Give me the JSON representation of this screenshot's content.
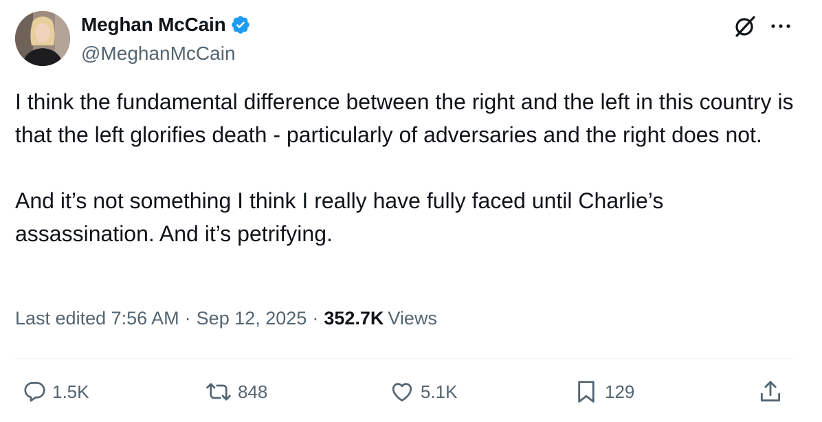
{
  "author": {
    "display_name": "Meghan McCain",
    "handle": "@MeghanMcCain",
    "verified": true,
    "verified_color": "#1d9bf0"
  },
  "tweet": {
    "paragraphs": [
      "I think the fundamental difference between the right and the left in this country is that the left glorifies death - particularly of adversaries and the right does not.",
      "And it’s not something I think I really have fully faced until Charlie’s assassination. And it’s petrifying."
    ]
  },
  "meta": {
    "edited_label": "Last edited 7:56 AM",
    "date": "Sep 12, 2025",
    "views_count": "352.7K",
    "views_label": "Views",
    "separator": "·"
  },
  "actions": {
    "replies": "1.5K",
    "reposts": "848",
    "likes": "5.1K",
    "bookmarks": "129"
  },
  "icons": [
    "grok-icon",
    "more-icon",
    "reply-icon",
    "repost-icon",
    "like-icon",
    "bookmark-icon",
    "share-icon",
    "verified-badge-icon"
  ],
  "colors": {
    "text": "#0f1419",
    "secondary": "#536471",
    "divider": "#eff3f4"
  }
}
